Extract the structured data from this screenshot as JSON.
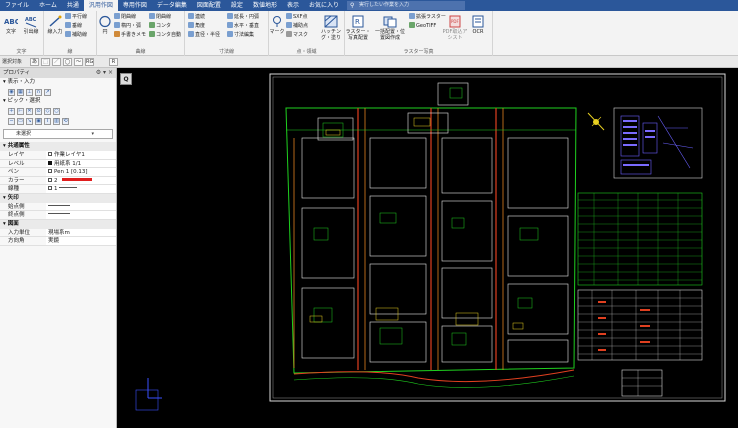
{
  "menu": {
    "tabs": [
      "ファイル",
      "ホーム",
      "共通",
      "汎用作図",
      "専用作図",
      "データ編集",
      "図面配置",
      "設定",
      "数値地形",
      "表示",
      "お気に入り"
    ],
    "active_index": 3,
    "search_placeholder": "実行したい作業を入力"
  },
  "ribbon": {
    "groups": {
      "text": "文字",
      "line": "線",
      "curve": "曲線",
      "dimension": "寸法線",
      "point_area": "点・領域",
      "raster": "ラスター写真"
    },
    "buttons": {
      "abc_text": "文字",
      "abc_leader": "引出線",
      "line_input": "線入力",
      "parallel_line": "平行線",
      "polyline": "垂線",
      "auxiliary": "補助線",
      "circle": "円",
      "ellipse": "楕円・弧",
      "freehand": "手書きメモ",
      "closed_curve": "閉曲線",
      "cons": "コンタ",
      "cons_auto": "コンタ自動",
      "continuous": "連続",
      "angle": "角度",
      "series_radius": "直径・半径",
      "extend_arc": "延長・円弧",
      "horizontal": "水平・垂直",
      "dim_edit": "寸法編集",
      "mark": "マーク",
      "sxf_point": "SXF点",
      "aux_point": "補助点",
      "mask": "マスク",
      "hatching": "ハッチング・塗り",
      "raster_photo": "ラスター・写真配置",
      "batch_place": "一括配置・位置図作成",
      "expand_raster": "拡張ラスター",
      "geotiff": "GeoTIFF",
      "pdf_assist": "PDF取込アシスト",
      "ocr": "OCR"
    }
  },
  "quickbar": {
    "label": "選択対象",
    "buttons": [
      "あ",
      "⬚",
      "／",
      "◯",
      "～",
      "RG",
      "R"
    ]
  },
  "properties": {
    "title": "プロパティ",
    "sections": {
      "display_input": "表示・入力",
      "pick_select": "ピック・選択"
    },
    "selection": "未選択",
    "categories": {
      "common": "共通属性",
      "arrow": "矢印",
      "drawing": "図面"
    },
    "rows": {
      "layer_key": "レイヤ",
      "layer_val": "作業レイヤ1",
      "level_key": "レベル",
      "level_val": "用紙系 1/1",
      "pen_key": "ペン",
      "pen_val": "Pen 1 [0.13]",
      "color_key": "カラー",
      "color_val": "2",
      "linetype_key": "線種",
      "linetype_val": "1",
      "start_key": "始点側",
      "end_key": "終点側",
      "unit_key": "入力単位",
      "unit_val": "現場系m",
      "dir_key": "方向角",
      "dir_val": "実鏡"
    },
    "colors": {
      "layer": "#ffffff",
      "level": "#ffffff",
      "pen_color": "#e01e1e"
    }
  },
  "canvas": {
    "view_tab": "Q",
    "background": "#000000"
  }
}
